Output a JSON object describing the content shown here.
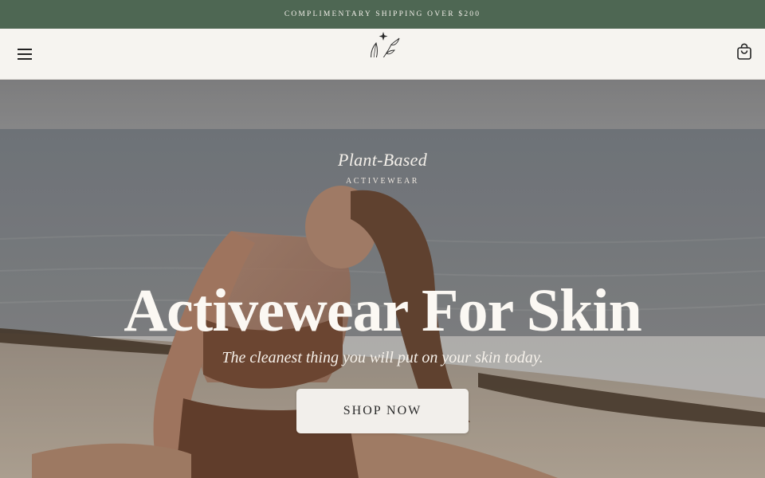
{
  "announcement": {
    "text": "COMPLIMENTARY SHIPPING OVER $200"
  },
  "header": {
    "menu_icon": "hamburger-menu-icon",
    "logo_icon": "leaf-star-logo-icon",
    "cart_icon": "shopping-bag-icon"
  },
  "hero": {
    "eyebrow": "Plant-Based",
    "eyebrow_sub": "ACTIVEWEAR",
    "headline": "Activewear For Skin",
    "tagline": "The cleanest thing you will put on your skin today.",
    "cta_label": "SHOP NOW"
  },
  "colors": {
    "announcement_bg": "#4e6753",
    "header_bg": "#f6f4f0",
    "cta_bg": "#f2efeb",
    "hero_text": "#fbf8f3"
  }
}
